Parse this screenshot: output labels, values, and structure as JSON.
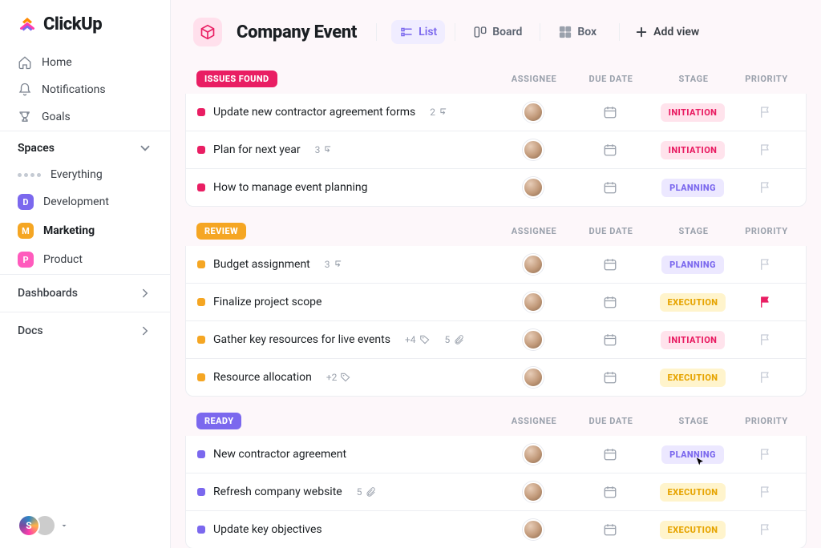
{
  "brand": {
    "name": "ClickUp"
  },
  "sidebar": {
    "nav": [
      {
        "label": "Home",
        "icon": "home-icon"
      },
      {
        "label": "Notifications",
        "icon": "bell-icon"
      },
      {
        "label": "Goals",
        "icon": "trophy-icon"
      }
    ],
    "spaces_header": "Spaces",
    "everything_label": "Everything",
    "spaces": [
      {
        "label": "Development",
        "letter": "D",
        "color": "#7b68ee",
        "active": false
      },
      {
        "label": "Marketing",
        "letter": "M",
        "color": "#f5a623",
        "active": true
      },
      {
        "label": "Product",
        "letter": "P",
        "color": "#ff5bbd",
        "active": false
      }
    ],
    "dash_rows": [
      {
        "label": "Dashboards"
      },
      {
        "label": "Docs"
      }
    ],
    "footer_initial": "S"
  },
  "header": {
    "title": "Company Event",
    "views": [
      {
        "label": "List",
        "active": true
      },
      {
        "label": "Board",
        "active": false
      },
      {
        "label": "Box",
        "active": false
      }
    ],
    "add_view": "Add view"
  },
  "columns": {
    "assignee": "ASSIGNEE",
    "due": "DUE DATE",
    "stage": "STAGE",
    "priority": "PRIORITY"
  },
  "stage_palette": {
    "INITIATION": {
      "bg": "#ffe3ec",
      "fg": "#e91e63"
    },
    "PLANNING": {
      "bg": "#ece8ff",
      "fg": "#7b68ee"
    },
    "EXECUTION": {
      "bg": "#fff4cc",
      "fg": "#e6a400"
    }
  },
  "groups": [
    {
      "name": "ISSUES FOUND",
      "color": "#e91e63",
      "task_color": "#e91e63",
      "tasks": [
        {
          "title": "Update new contractor agreement forms",
          "sub": "2",
          "sub_icon": "subtask",
          "stage": "INITIATION"
        },
        {
          "title": "Plan for next year",
          "sub": "3",
          "sub_icon": "subtask",
          "stage": "INITIATION"
        },
        {
          "title": "How to manage event planning",
          "stage": "PLANNING"
        }
      ]
    },
    {
      "name": "REVIEW",
      "color": "#f5a623",
      "task_color": "#f5a623",
      "tasks": [
        {
          "title": "Budget assignment",
          "sub": "3",
          "sub_icon": "subtask",
          "stage": "PLANNING"
        },
        {
          "title": "Finalize project scope",
          "stage": "EXECUTION",
          "priority_flagged": true
        },
        {
          "title": "Gather key resources for live events",
          "tag_plus": "+4",
          "attach": "5",
          "stage": "INITIATION"
        },
        {
          "title": "Resource allocation",
          "tag_plus": "+2",
          "show_tag_icon": true,
          "stage": "EXECUTION"
        }
      ]
    },
    {
      "name": "READY",
      "color": "#7b68ee",
      "task_color": "#7b68ee",
      "tasks": [
        {
          "title": "New contractor agreement",
          "stage": "PLANNING",
          "cursor": true
        },
        {
          "title": "Refresh company website",
          "attach": "5",
          "stage": "EXECUTION"
        },
        {
          "title": "Update key objectives",
          "stage": "EXECUTION"
        }
      ]
    }
  ]
}
